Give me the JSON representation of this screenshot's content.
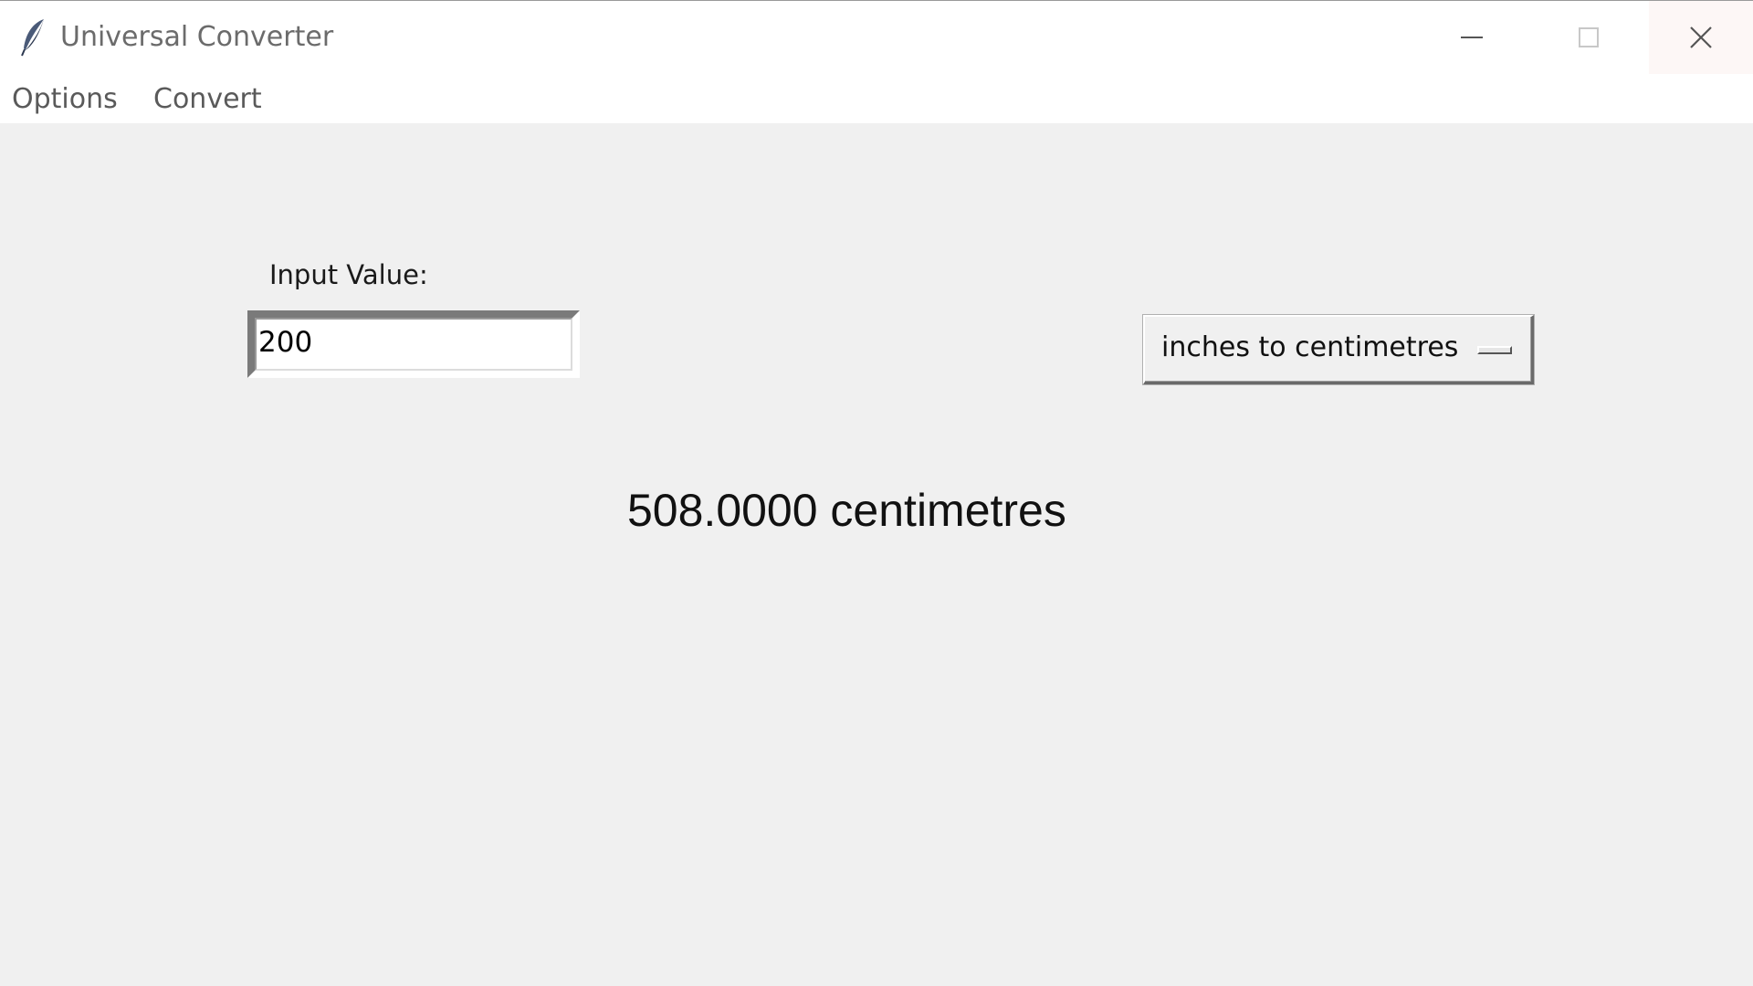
{
  "window": {
    "title": "Universal Converter",
    "icon": "feather-icon",
    "controls": {
      "minimize": "minimize-icon",
      "maximize": "maximize-icon",
      "close": "close-icon"
    }
  },
  "menubar": {
    "items": [
      {
        "label": "Options"
      },
      {
        "label": "Convert"
      }
    ]
  },
  "input": {
    "label": "Input Value:",
    "value": "200"
  },
  "conversion": {
    "selected": "inches to centimetres"
  },
  "result": {
    "text": "508.0000 centimetres"
  }
}
